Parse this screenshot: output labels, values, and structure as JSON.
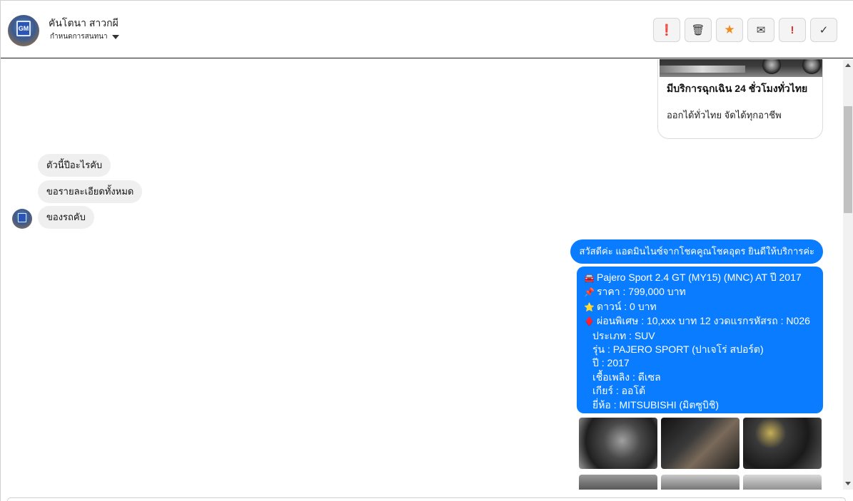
{
  "header": {
    "contact_name": "คันโตนา สาวกผี",
    "status_label": "กำหนดการสนทนา",
    "actions": [
      {
        "icon": "alert-circle-icon",
        "glyph": "❗"
      },
      {
        "icon": "trash-icon",
        "glyph": "🗑"
      },
      {
        "icon": "star-icon",
        "glyph": "★"
      },
      {
        "icon": "mail-icon",
        "glyph": "✉"
      },
      {
        "icon": "exclamation-icon",
        "glyph": "!"
      },
      {
        "icon": "check-icon",
        "glyph": "✓"
      }
    ]
  },
  "card": {
    "title": "มีบริการฉุกเฉิน 24 ชั่วโมงทั่วไทย",
    "description": "ออกได้ทั่วไทย จัดได้ทุกอาชีพ"
  },
  "incoming": [
    "ตัวนี้ปีอะไรคับ",
    "ขอรายละเอียดทั้งหมด",
    "ของรถคับ"
  ],
  "outgoing_greeting": "สวัสดีค่ะ แอดมินไนซ์จากโชคคูณโชคอุดร ยินดีให้บริการค่ะ",
  "details": [
    {
      "emoji": "🚘",
      "text": "Pajero Sport 2.4 GT (MY15) (MNC) AT ปี 2017"
    },
    {
      "emoji": "📌",
      "text": "ราคา : 799,000 บาท"
    },
    {
      "emoji": "⭐",
      "text": "ดาวน์ : 0 บาท"
    },
    {
      "emoji": "♦️",
      "text": "ผ่อนพิเศษ : 10,xxx บาท 12 งวดแรกรหัสรถ : N026"
    },
    {
      "emoji": "",
      "text": "ประเภท : SUV"
    },
    {
      "emoji": "",
      "text": "รุ่น : PAJERO SPORT (ปาเจโร่ สปอร์ต)"
    },
    {
      "emoji": "",
      "text": "ปี : 2017"
    },
    {
      "emoji": "",
      "text": "เชื้อเพลิง : ดีเซล"
    },
    {
      "emoji": "",
      "text": "เกียร์ : ออโต้"
    },
    {
      "emoji": "",
      "text": "ยี่ห้อ : MITSUBISHI (มิตซูบิชิ)"
    }
  ]
}
